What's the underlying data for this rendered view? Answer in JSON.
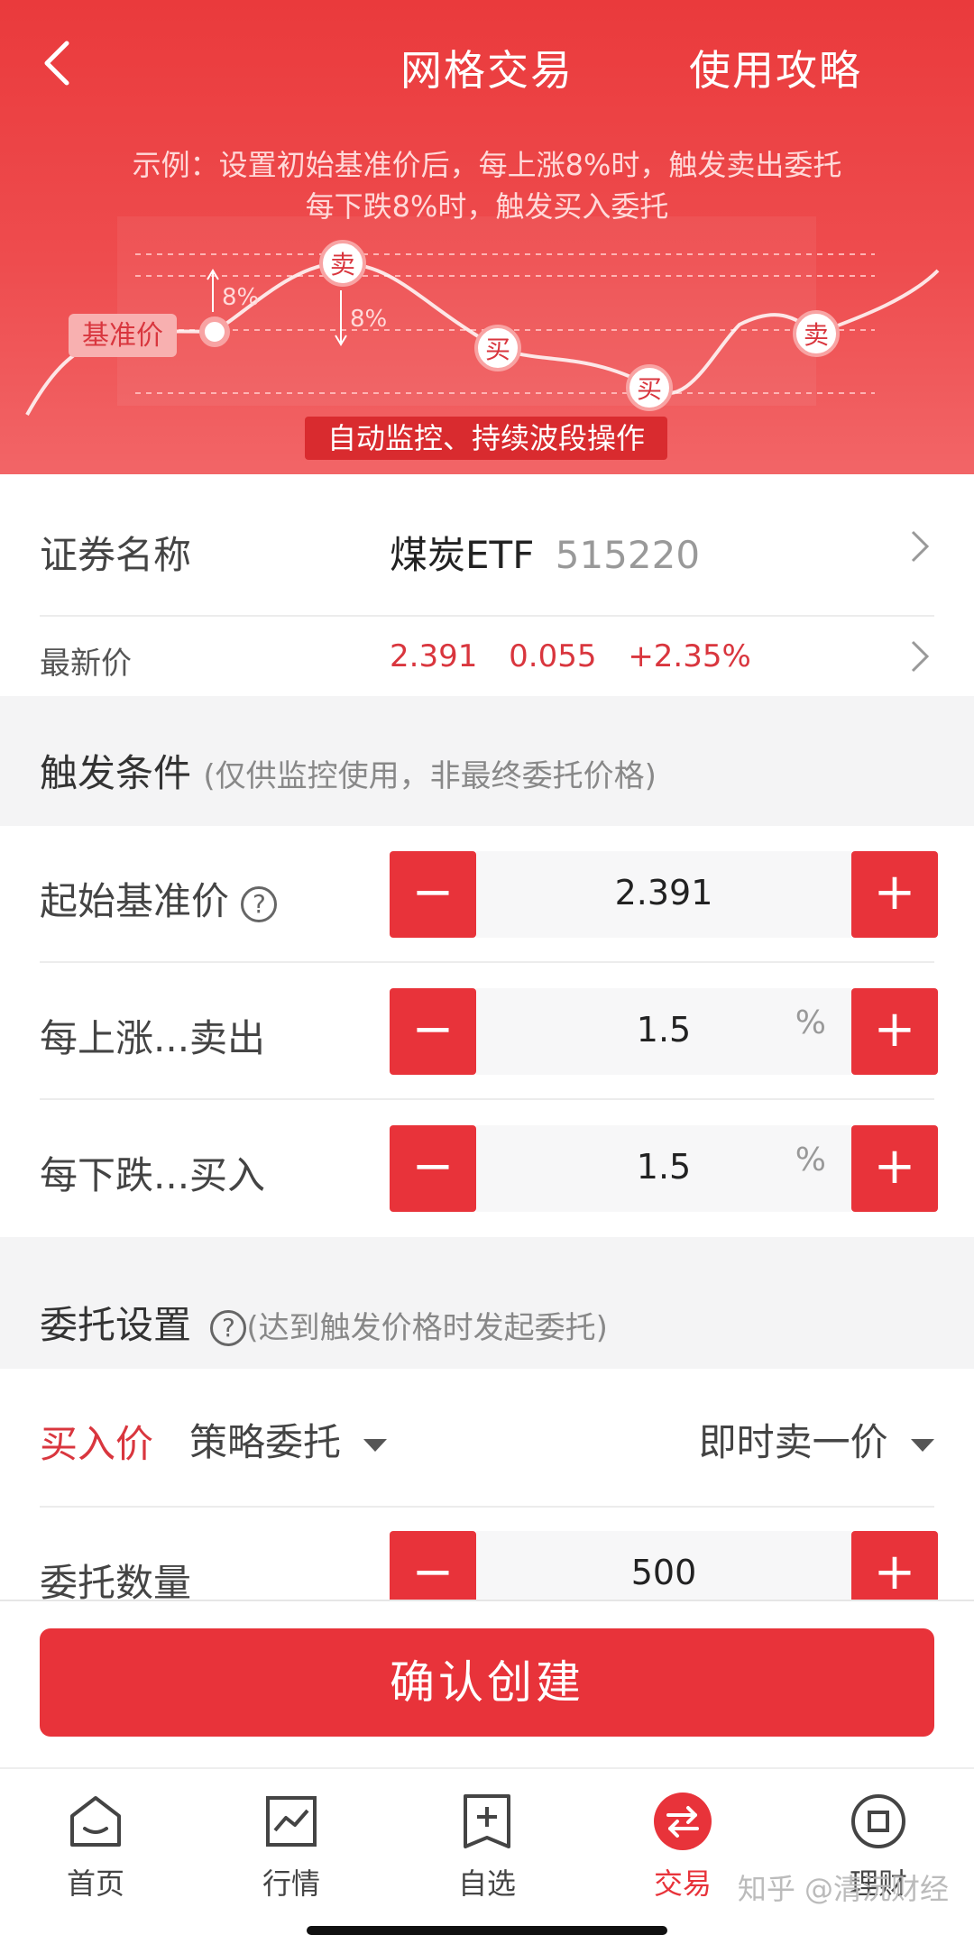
{
  "header": {
    "title": "网格交易",
    "guide_label": "使用攻略",
    "desc_line1": "示例：设置初始基准价后，每上涨8%时，触发卖出委托",
    "desc_line2": "每下跌8%时，触发买入委托",
    "base_label": "基准价",
    "up_pct": "8%",
    "down_pct": "8%",
    "sell_mark": "卖",
    "buy_mark": "买",
    "banner": "自动监控、持续波段操作"
  },
  "security": {
    "label": "证券名称",
    "name": "煤炭ETF",
    "code": "515220"
  },
  "latest": {
    "label": "最新价",
    "price": "2.391",
    "change": "0.055",
    "change_pct": "+2.35%"
  },
  "trigger": {
    "title": "触发条件",
    "subtitle": "(仅供监控使用，非最终委托价格)",
    "base_price_label": "起始基准价",
    "base_price_value": "2.391",
    "rise_label": "每上涨...卖出",
    "rise_value": "1.5",
    "fall_label": "每下跌...买入",
    "fall_value": "1.5",
    "unit": "%"
  },
  "order": {
    "title": "委托设置",
    "subtitle": "(达到触发价格时发起委托)",
    "buy_price_label": "买入价",
    "strategy_select": "策略委托",
    "price_type_select": "即时卖一价",
    "qty_label": "委托数量",
    "qty_value": "500"
  },
  "confirm_label": "确认创建",
  "tabs": [
    {
      "label": "首页"
    },
    {
      "label": "行情"
    },
    {
      "label": "自选"
    },
    {
      "label": "交易"
    },
    {
      "label": "理财"
    }
  ],
  "watermark": "知乎 @清沅财经",
  "colors": {
    "accent": "#e8333a",
    "price_up": "#d9363e"
  },
  "stepper_minus": "−",
  "stepper_plus": "+",
  "help_glyph": "?"
}
